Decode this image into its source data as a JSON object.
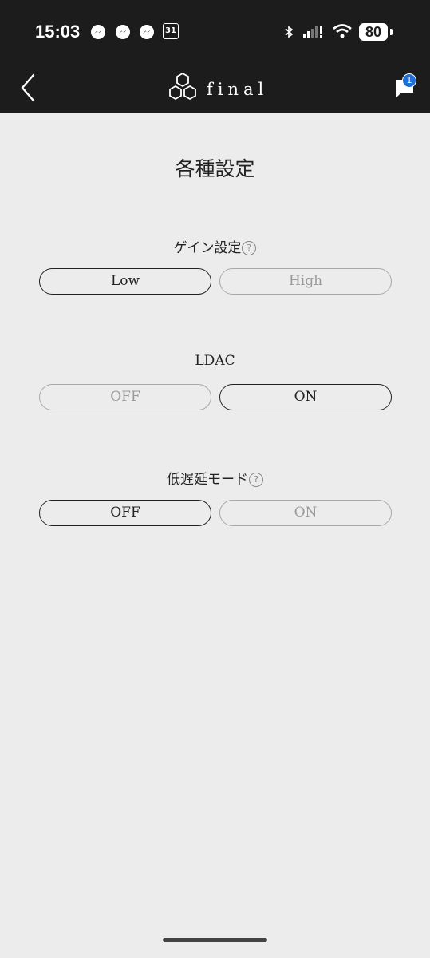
{
  "status_bar": {
    "time": "15:03",
    "calendar_day": "31",
    "battery": "80"
  },
  "header": {
    "brand": "final",
    "notification_count": "1"
  },
  "page": {
    "title": "各種設定"
  },
  "settings": {
    "gain": {
      "label": "ゲイン設定",
      "help": "?",
      "options": [
        "Low",
        "High"
      ],
      "selected": "Low"
    },
    "ldac": {
      "label": "LDAC",
      "options": [
        "OFF",
        "ON"
      ],
      "selected": "ON"
    },
    "low_latency": {
      "label": "低遅延モード",
      "help": "?",
      "options": [
        "OFF",
        "ON"
      ],
      "selected": "OFF"
    }
  }
}
